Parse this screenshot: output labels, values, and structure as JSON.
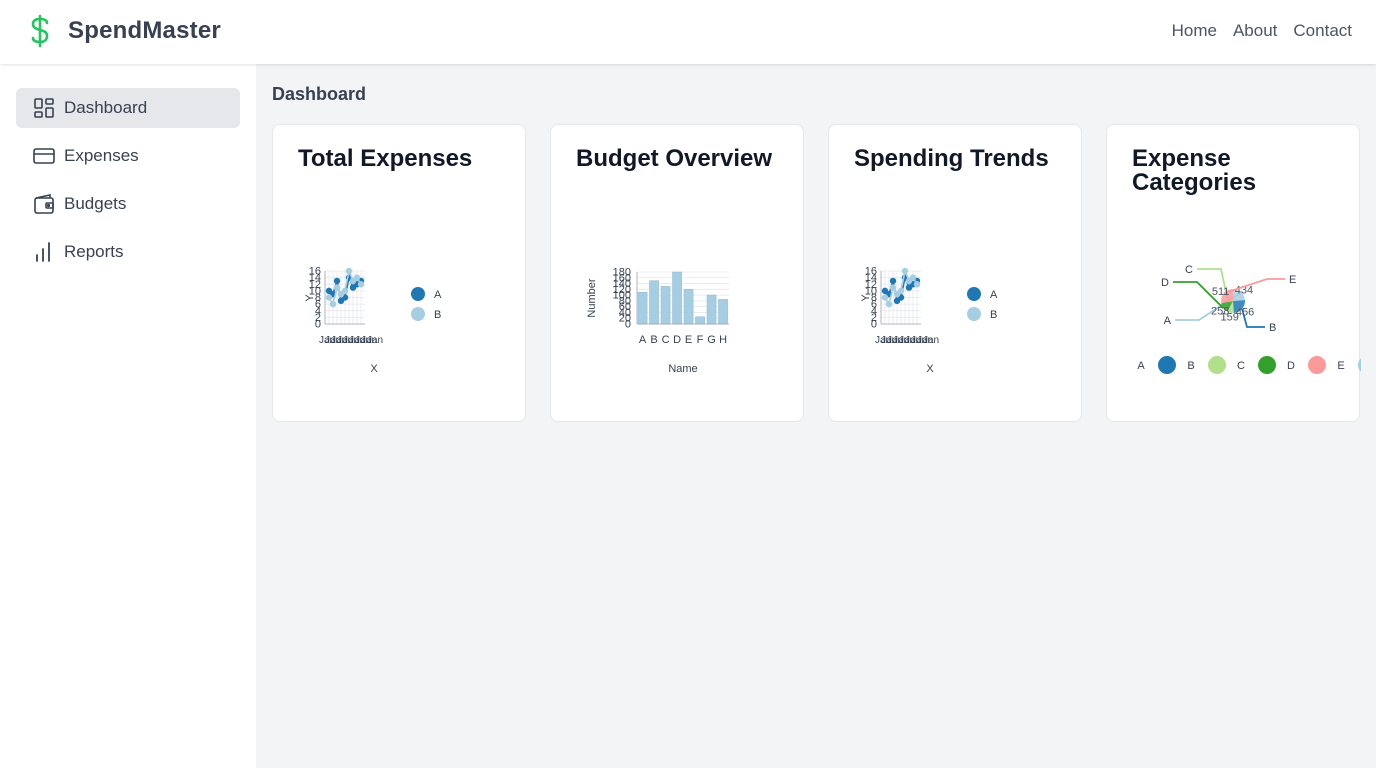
{
  "app": {
    "name": "SpendMaster",
    "icon": "dollar-icon",
    "accent_color": "#22c55e"
  },
  "topnav": {
    "items": [
      "Home",
      "About",
      "Contact"
    ]
  },
  "sidebar": {
    "items": [
      {
        "label": "Dashboard",
        "icon": "dashboard-icon",
        "active": true
      },
      {
        "label": "Expenses",
        "icon": "credit-card-icon",
        "active": false
      },
      {
        "label": "Budgets",
        "icon": "wallet-icon",
        "active": false
      },
      {
        "label": "Reports",
        "icon": "bar-chart-icon",
        "active": false
      }
    ]
  },
  "main": {
    "title": "Dashboard",
    "cards": [
      {
        "title": "Total Expenses"
      },
      {
        "title": "Budget Overview"
      },
      {
        "title": "Spending Trends"
      },
      {
        "title": "Expense Categories"
      }
    ]
  },
  "chart_data": [
    {
      "type": "scatter",
      "xlabel": "X",
      "ylabel": "Y",
      "ylim": [
        0,
        16
      ],
      "yticks": [
        "0",
        "2",
        "4",
        "6",
        "8",
        "10",
        "12",
        "14",
        "16"
      ],
      "x": [
        "Jan",
        "Jan",
        "Jan",
        "Jan",
        "Jan",
        "Jan",
        "Jan",
        "Jan",
        "Jan"
      ],
      "series": [
        {
          "name": "A",
          "color": "#1f77b4",
          "values": [
            10,
            9,
            13,
            7,
            8,
            14,
            11,
            12,
            13
          ]
        },
        {
          "name": "B",
          "color": "#a6cee3",
          "values": [
            8,
            6,
            11,
            9,
            10,
            16,
            13,
            14,
            12
          ]
        }
      ],
      "legend": "right"
    },
    {
      "type": "bar",
      "xlabel": "Name",
      "ylabel": "Number",
      "ylim": [
        0,
        180
      ],
      "yticks": [
        "0",
        "20",
        "40",
        "60",
        "80",
        "100",
        "120",
        "140",
        "160",
        "180"
      ],
      "categories": [
        "A",
        "B",
        "C",
        "D",
        "E",
        "F",
        "G",
        "H"
      ],
      "values": [
        110,
        150,
        130,
        180,
        120,
        25,
        100,
        85
      ],
      "color": "#a6cee3"
    },
    {
      "type": "scatter",
      "xlabel": "X",
      "ylabel": "Y",
      "ylim": [
        0,
        16
      ],
      "yticks": [
        "0",
        "2",
        "4",
        "6",
        "8",
        "10",
        "12",
        "14",
        "16"
      ],
      "x": [
        "Jan",
        "Jan",
        "Jan",
        "Jan",
        "Jan",
        "Jan",
        "Jan",
        "Jan",
        "Jan"
      ],
      "series": [
        {
          "name": "A",
          "color": "#1f77b4",
          "values": [
            10,
            9,
            13,
            7,
            8,
            14,
            11,
            12,
            13
          ]
        },
        {
          "name": "B",
          "color": "#a6cee3",
          "values": [
            8,
            6,
            11,
            9,
            10,
            16,
            13,
            14,
            12
          ]
        }
      ],
      "legend": "right"
    },
    {
      "type": "pie",
      "labels": [
        "A",
        "B",
        "C",
        "D",
        "E"
      ],
      "values": [
        434,
        456,
        159,
        258,
        511
      ],
      "value_labels": [
        "434",
        "456",
        "159",
        "258",
        "511"
      ],
      "colors": [
        "#a6cee3",
        "#1f77b4",
        "#b2df8a",
        "#33a02c",
        "#fb9a99"
      ],
      "legend": "bottom"
    }
  ]
}
